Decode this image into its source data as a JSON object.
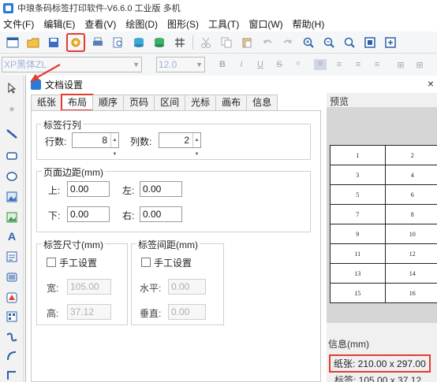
{
  "app": {
    "title": "中琅条码标签打印软件-V6.6.0 工业版 多机"
  },
  "menu": [
    "文件(F)",
    "编辑(E)",
    "查看(V)",
    "绘图(D)",
    "图形(S)",
    "工具(T)",
    "窗口(W)",
    "帮助(H)"
  ],
  "toolbar": {
    "icons": [
      "new-icon",
      "open-icon",
      "save-icon",
      "document-settings-icon",
      "print-icon",
      "print-preview-icon",
      "database-icon",
      "database-settings-icon",
      "grid-icon",
      "cut-icon",
      "copy-icon",
      "paste-icon",
      "undo-icon",
      "redo-icon",
      "zoom-in-icon",
      "zoom-out-icon",
      "zoom-fit-icon",
      "zoom-page-icon",
      "zoom-actual-icon"
    ],
    "highlighted": "document-settings-icon",
    "highlight_color": "#e53b2f"
  },
  "format_bar": {
    "font": "XP黑体ZL",
    "size": "12.0",
    "buttons": [
      "B",
      "I",
      "U",
      "S",
      "⁰"
    ]
  },
  "dialog": {
    "title": "文档设置",
    "close": "×",
    "tabs": [
      "纸张",
      "布局",
      "顺序",
      "页码",
      "区间",
      "光标",
      "画布",
      "信息"
    ],
    "active_tab": "布局",
    "rows_cols": {
      "legend": "标签行列",
      "rows_label": "行数:",
      "rows_value": "8",
      "cols_label": "列数:",
      "cols_value": "2"
    },
    "margins": {
      "legend": "页面边距(mm)",
      "top_label": "上:",
      "top_value": "0.00",
      "left_label": "左:",
      "left_value": "0.00",
      "bottom_label": "下:",
      "bottom_value": "0.00",
      "right_label": "右:",
      "right_value": "0.00"
    },
    "label_size": {
      "legend": "标签尺寸(mm)",
      "manual": "手工设置",
      "width_label": "宽:",
      "width_value": "105.00",
      "height_label": "高:",
      "height_value": "37.12"
    },
    "label_gap": {
      "legend": "标签间距(mm)",
      "manual": "手工设置",
      "h_label": "水平:",
      "h_value": "0.00",
      "v_label": "垂直:",
      "v_value": "0.00"
    },
    "preview": {
      "label": "预览",
      "cells": [
        [
          "1",
          "2"
        ],
        [
          "3",
          "4"
        ],
        [
          "5",
          "6"
        ],
        [
          "7",
          "8"
        ],
        [
          "9",
          "10"
        ],
        [
          "11",
          "12"
        ],
        [
          "13",
          "14"
        ],
        [
          "15",
          "16"
        ]
      ]
    },
    "info": {
      "legend": "信息(mm)",
      "paper": "纸张: 210.00 x 297.00",
      "label": "标签: 105.00 x 37.12"
    }
  }
}
